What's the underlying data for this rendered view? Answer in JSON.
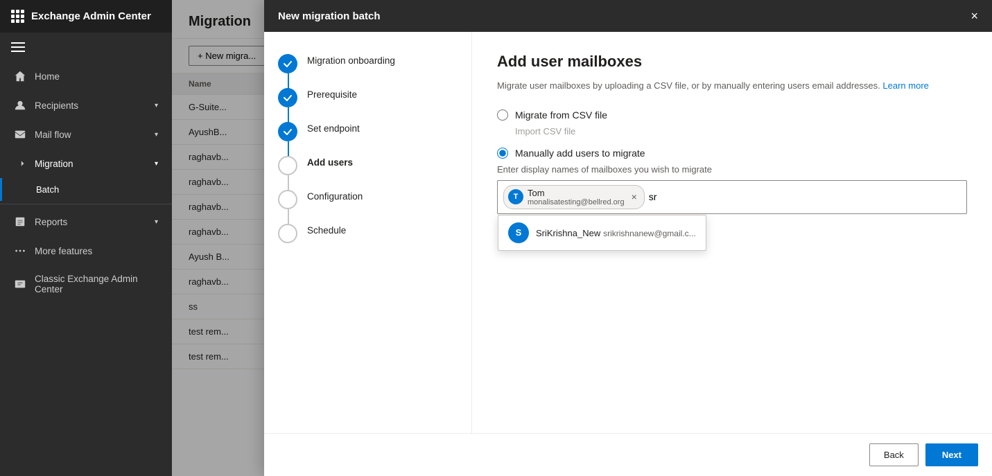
{
  "app": {
    "title": "Exchange Admin Center"
  },
  "sidebar": {
    "menu_items": [
      {
        "id": "home",
        "label": "Home",
        "icon": "home-icon",
        "has_chevron": false
      },
      {
        "id": "recipients",
        "label": "Recipients",
        "icon": "recipients-icon",
        "has_chevron": true
      },
      {
        "id": "mail-flow",
        "label": "Mail flow",
        "icon": "mailflow-icon",
        "has_chevron": true
      },
      {
        "id": "migration",
        "label": "Migration",
        "icon": "migration-icon",
        "has_chevron": true
      }
    ],
    "sub_items": [
      {
        "id": "batch",
        "label": "Batch",
        "active": true
      }
    ],
    "bottom_items": [
      {
        "id": "reports",
        "label": "Reports",
        "icon": "reports-icon",
        "has_chevron": true
      },
      {
        "id": "more-features",
        "label": "More features",
        "icon": "more-icon",
        "has_chevron": false
      },
      {
        "id": "classic",
        "label": "Classic Exchange Admin Center",
        "icon": "classic-icon",
        "has_chevron": false
      }
    ]
  },
  "main": {
    "title": "Migration",
    "toolbar": {
      "new_migration_label": "+ New migra..."
    },
    "table": {
      "column_name": "Name",
      "rows": [
        {
          "name": "G-Suite..."
        },
        {
          "name": "AyushB..."
        },
        {
          "name": "raghavb..."
        },
        {
          "name": "raghavb..."
        },
        {
          "name": "raghavb..."
        },
        {
          "name": "raghavb..."
        },
        {
          "name": "Ayush B..."
        },
        {
          "name": "raghavb..."
        },
        {
          "name": "ss"
        },
        {
          "name": "test rem..."
        },
        {
          "name": "test rem..."
        }
      ]
    }
  },
  "modal": {
    "title": "New migration batch",
    "close_label": "×",
    "steps": [
      {
        "id": "migration-onboarding",
        "label": "Migration onboarding",
        "state": "completed"
      },
      {
        "id": "prerequisite",
        "label": "Prerequisite",
        "state": "completed"
      },
      {
        "id": "set-endpoint",
        "label": "Set endpoint",
        "state": "completed"
      },
      {
        "id": "add-users",
        "label": "Add users",
        "state": "active"
      },
      {
        "id": "configuration",
        "label": "Configuration",
        "state": "inactive"
      },
      {
        "id": "schedule",
        "label": "Schedule",
        "state": "inactive"
      }
    ],
    "content": {
      "heading": "Add user mailboxes",
      "subtitle_text": "Migrate user mailboxes by uploading a CSV file, or by manually entering users email addresses.",
      "learn_more": "Learn more",
      "csv_option_label": "Migrate from CSV file",
      "csv_hint": "Import CSV file",
      "manual_option_label": "Manually add users to migrate",
      "input_label": "Enter display names of mailboxes you wish to migrate",
      "existing_tag": {
        "initials": "T",
        "name": "Tom",
        "email": "monalisatesting@bellred.org"
      },
      "search_value": "sr",
      "autocomplete": {
        "initials": "S",
        "name": "SriKrishna_New",
        "email": "srikrishnanew@gmail.c..."
      }
    },
    "footer": {
      "back_label": "Back",
      "next_label": "Next"
    }
  }
}
